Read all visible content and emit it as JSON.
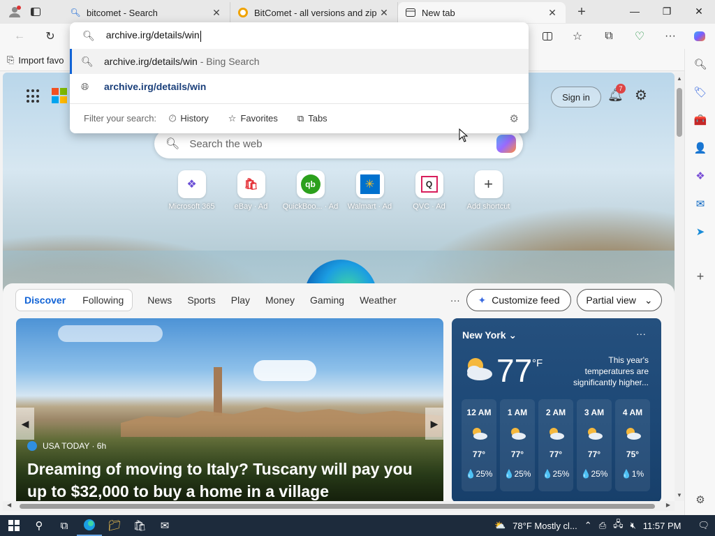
{
  "tabs": [
    {
      "label": "bitcomet - Search",
      "icon": "search-icon"
    },
    {
      "label": "BitComet - all versions and zip p",
      "icon": "archive-icon"
    },
    {
      "label": "New tab",
      "icon": "newtab-icon",
      "active": true
    }
  ],
  "address": {
    "value": "archive.irg/details/win",
    "suggestions": [
      {
        "text": "archive.irg/details/win",
        "suffix": " - Bing Search",
        "icon": "search-icon"
      },
      {
        "text": "archive.irg/details/win",
        "suffix": "",
        "icon": "globe-icon"
      }
    ],
    "filter_label": "Filter your search:",
    "filters": [
      "History",
      "Favorites",
      "Tabs"
    ]
  },
  "favorites_bar": {
    "import_label": "Import favo"
  },
  "newtab": {
    "signin": "Sign in",
    "notif_count": "7",
    "search_placeholder": "Search the web",
    "shortcuts": [
      {
        "name": "Microsoft 365",
        "glyph": "❖",
        "color": "#6b4fd6"
      },
      {
        "name": "eBay · Ad",
        "glyph": "🛍",
        "color": "#e53238"
      },
      {
        "name": "QuickBoo... · Ad",
        "glyph": "qb",
        "color": "#2ca01c"
      },
      {
        "name": "Walmart · Ad",
        "glyph": "✳",
        "color": "#0071ce"
      },
      {
        "name": "QVC · Ad",
        "glyph": "Q",
        "color": "#d81e5b"
      },
      {
        "name": "Add shortcut",
        "glyph": "+",
        "color": "#444"
      }
    ]
  },
  "feed": {
    "pills": [
      "Discover",
      "Following"
    ],
    "nav": [
      "News",
      "Sports",
      "Play",
      "Money",
      "Gaming",
      "Weather"
    ],
    "more": "···",
    "customize": "Customize feed",
    "partial": "Partial view"
  },
  "hero": {
    "source": "USA TODAY · 6h",
    "headline": "Dreaming of moving to Italy? Tuscany will pay you up to $32,000 to buy a home in a village"
  },
  "weather": {
    "city": "New York",
    "temp": "77",
    "unit": "°F",
    "note": "This year's temperatures are significantly higher...",
    "hours": [
      {
        "label": "12 AM",
        "temp": "77°",
        "precip": "💧25%"
      },
      {
        "label": "1 AM",
        "temp": "77°",
        "precip": "💧25%"
      },
      {
        "label": "2 AM",
        "temp": "77°",
        "precip": "💧25%"
      },
      {
        "label": "3 AM",
        "temp": "77°",
        "precip": "💧25%"
      },
      {
        "label": "4 AM",
        "temp": "75°",
        "precip": "💧1%"
      }
    ]
  },
  "taskbar": {
    "weather": "78°F  Mostly cl...",
    "time": "11:57 PM"
  }
}
